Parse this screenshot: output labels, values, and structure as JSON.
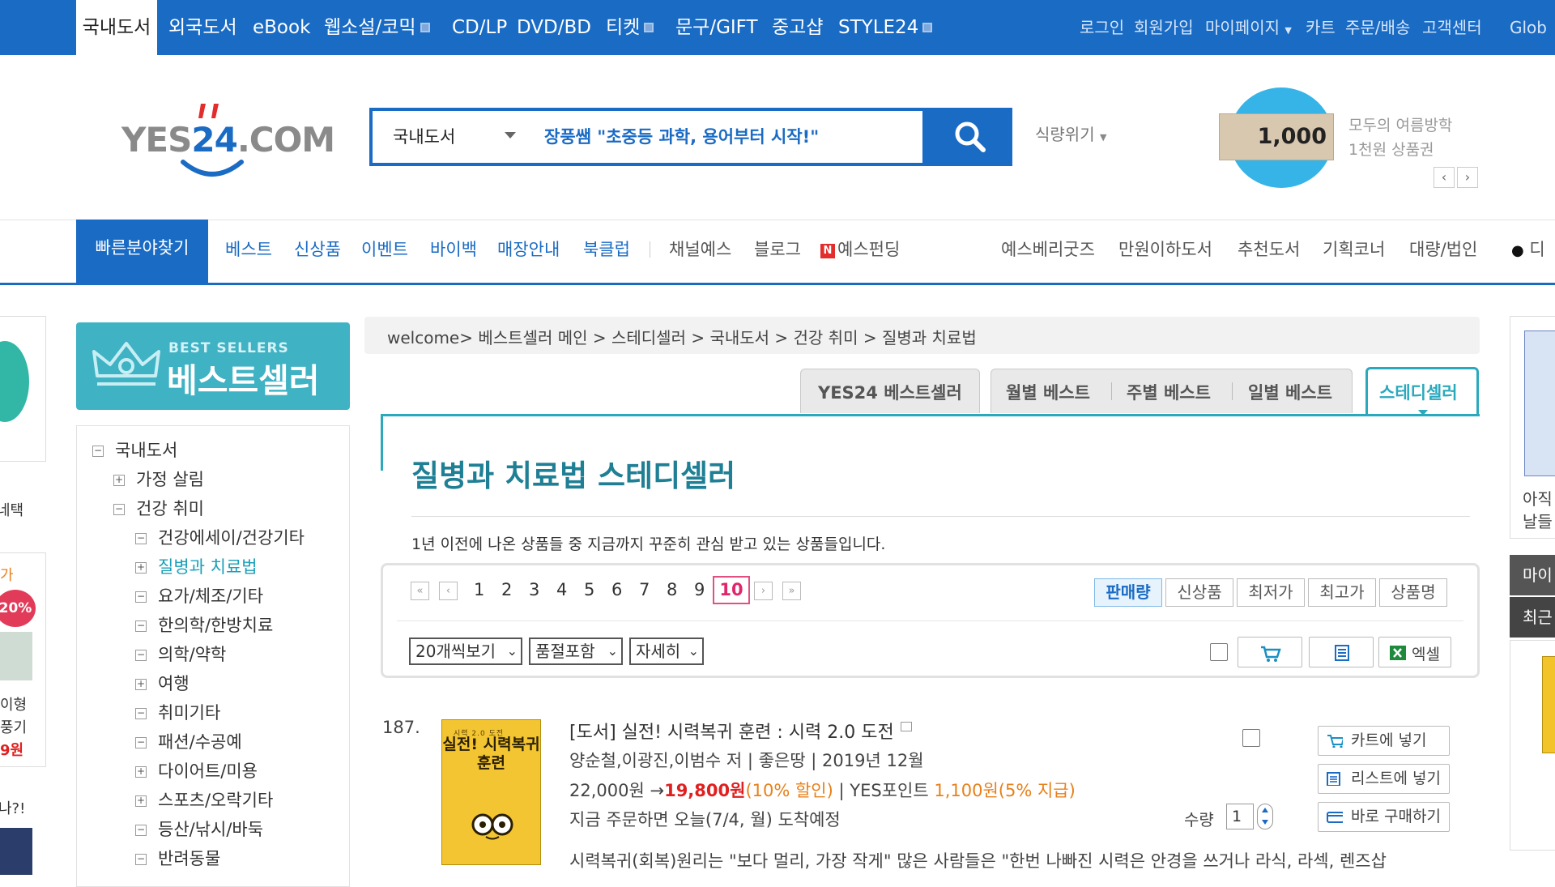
{
  "topbar": {
    "tabs": [
      "국내도서",
      "외국도서",
      "eBook",
      "웹소설/코믹",
      "CD/LP",
      "DVD/BD",
      "티켓",
      "문구/GIFT",
      "중고샵",
      "STYLE24"
    ],
    "utils": [
      "로그인",
      "회원가입",
      "마이페이지",
      "카트",
      "주문/배송",
      "고객센터",
      "Glob"
    ]
  },
  "logo": {
    "pre": "YES",
    "num": "24",
    "post": ".COM"
  },
  "search": {
    "category": "국내도서",
    "query": "장풍쌤 \"초중등 과학, 용어부터 시작!\"",
    "smart": "식량위기"
  },
  "promo": {
    "amount": "1,000",
    "title": "모두의 여름방학",
    "subtitle": "1천원 상품권"
  },
  "nav2": {
    "quick_find": "빠른분야찾기",
    "blue_items": [
      "베스트",
      "신상품",
      "이벤트",
      "바이백",
      "매장안내",
      "북클럽"
    ],
    "gray_items": [
      "채널예스",
      "블로그"
    ],
    "funding": "예스펀딩",
    "right_items": [
      "예스베리굿즈",
      "만원이하도서",
      "추천도서",
      "기획코너",
      "대량/법인",
      "디"
    ]
  },
  "left_edge": {
    "t1": "네택",
    "t2": "가",
    "t3": "20%",
    "t4": "이형",
    "t5": "풍기",
    "t6": "9원",
    "t7": "나?!"
  },
  "bestseller_banner": {
    "eng": "BEST SELLERS",
    "kor": "베스트셀러"
  },
  "tree": [
    {
      "label": "국내도서",
      "toggle": "−"
    },
    {
      "label": "가정 살림",
      "toggle": "+"
    },
    {
      "label": "건강 취미",
      "toggle": "−"
    },
    {
      "label": "건강에세이/건강기타",
      "toggle": "−"
    },
    {
      "label": "질병과 치료법",
      "toggle": "+"
    },
    {
      "label": "요가/체조/기타",
      "toggle": "−"
    },
    {
      "label": "한의학/한방치료",
      "toggle": "−"
    },
    {
      "label": "의학/약학",
      "toggle": "−"
    },
    {
      "label": "여행",
      "toggle": "+"
    },
    {
      "label": "취미기타",
      "toggle": "−"
    },
    {
      "label": "패션/수공예",
      "toggle": "−"
    },
    {
      "label": "다이어트/미용",
      "toggle": "+"
    },
    {
      "label": "스포츠/오락기타",
      "toggle": "+"
    },
    {
      "label": "등산/낚시/바둑",
      "toggle": "−"
    },
    {
      "label": "반려동물",
      "toggle": "−"
    }
  ],
  "breadcrumb": "welcome> 베스트셀러 메인 > 스테디셀러 > 국내도서 > 건강 취미 > 질병과 치료법",
  "tabs": {
    "yes24": "YES24 베스트셀러",
    "monthly": "월별 베스트",
    "weekly": "주별 베스트",
    "daily": "일별 베스트",
    "steady": "스테디셀러"
  },
  "page_title": "질병과 치료법 스테디셀러",
  "description": "1년 이전에 나온 상품들 중 지금까지 꾸준히 관심 받고 있는 상품들입니다.",
  "pagination": {
    "pages": [
      "1",
      "2",
      "3",
      "4",
      "5",
      "6",
      "7",
      "8",
      "9"
    ],
    "current": "10"
  },
  "sort": [
    "판매량",
    "신상품",
    "최저가",
    "최고가",
    "상품명"
  ],
  "view_options": {
    "per_page": "20개씩보기",
    "soldout": "품절포함",
    "detail": "자세히",
    "excel": "엑셀"
  },
  "product": {
    "rank": "187.",
    "cover_top": "시력 2.0 도전",
    "cover_title": "실전! 시력복귀 훈련",
    "title": "[도서] 실전! 시력복귀 훈련 : 시력 2.0 도전",
    "author": "양순철,이광진,이범수 저 | 좋은땅 | 2019년 12월",
    "price_orig": "22,000원 →",
    "price_sale": "19,800원",
    "discount": "(10% 할인)",
    "points_label": " | YES포인트 ",
    "points": "1,100원",
    "points_rate": "(5% 지급)",
    "delivery": "지금 주문하면 오늘(7/4, 월) 도착예정",
    "intro": "시력복귀(회복)원리는 \"보다 멀리, 가장 작게\" 많은 사람들은 \"한번 나빠진 시력은 안경을 쓰거나 라식, 라섹, 렌즈삽",
    "qty_label": "수량",
    "qty": "1",
    "btn_cart": "카트에 넣기",
    "btn_list": "리스트에 넣기",
    "btn_buy": "바로 구매하기"
  },
  "right_edge": {
    "t1": "아직",
    "t2": "날들",
    "t3": "마이",
    "t4": "최근"
  },
  "colors": {
    "brand_blue": "#1a6bc4",
    "teal": "#2aa9bd",
    "sale_red": "#e02020",
    "point_orange": "#e8801a",
    "current_page": "#e0266c"
  }
}
